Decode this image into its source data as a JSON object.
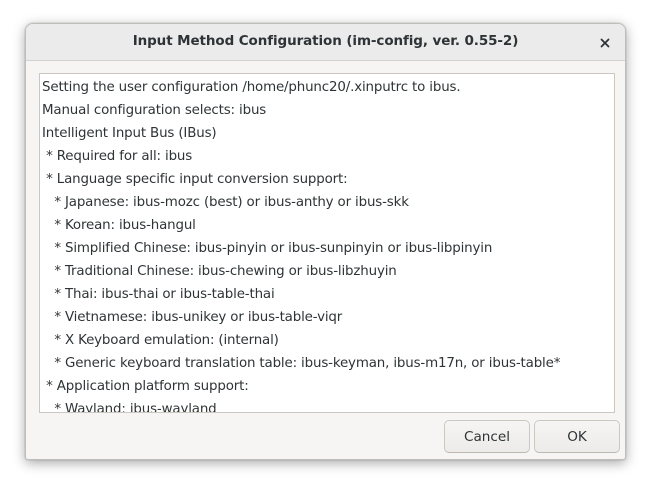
{
  "dialog": {
    "title": "Input Method Configuration (im-config, ver. 0.55-2)",
    "close_icon": "close-icon"
  },
  "message": {
    "lines": [
      "Setting the user configuration /home/phunc20/.xinputrc to ibus.",
      "Manual configuration selects: ibus",
      "Intelligent Input Bus (IBus)",
      " * Required for all: ibus",
      " * Language specific input conversion support:",
      "   * Japanese: ibus-mozc (best) or ibus-anthy or ibus-skk",
      "   * Korean: ibus-hangul",
      "   * Simplified Chinese: ibus-pinyin or ibus-sunpinyin or ibus-libpinyin",
      "   * Traditional Chinese: ibus-chewing or ibus-libzhuyin",
      "   * Thai: ibus-thai or ibus-table-thai",
      "   * Vietnamese: ibus-unikey or ibus-table-viqr",
      "   * X Keyboard emulation: (internal)",
      "   * Generic keyboard translation table: ibus-keyman, ibus-m17n, or ibus-table*",
      " * Application platform support:",
      "   * Wayland: ibus-wayland"
    ]
  },
  "buttons": {
    "cancel_label": "Cancel",
    "ok_label": "OK"
  }
}
